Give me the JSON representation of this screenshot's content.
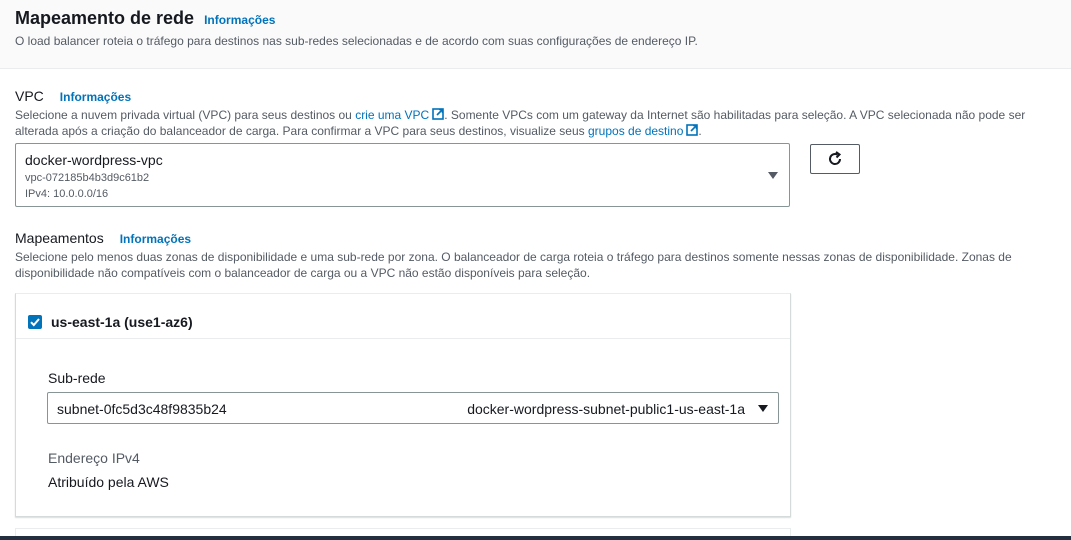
{
  "section": {
    "title": "Mapeamento de rede",
    "info_label": "Informações",
    "description": "O load balancer roteia o tráfego para destinos nas sub-redes selecionadas e de acordo com suas configurações de endereço IP."
  },
  "vpc": {
    "label": "VPC",
    "info_label": "Informações",
    "desc_part1": "Selecione a nuvem privada virtual (VPC) para seus destinos ou ",
    "create_vpc_link": "crie uma VPC",
    "desc_part2": ". Somente VPCs com um gateway da Internet são habilitadas para seleção. A VPC selecionada não pode ser alterada após a criação do balanceador de carga. Para confirmar a VPC para seus destinos, visualize seus ",
    "target_groups_link": "grupos de destino",
    "desc_part3": ".",
    "selected": {
      "name": "docker-wordpress-vpc",
      "id": "vpc-072185b4b3d9c61b2",
      "cidr": "IPv4: 10.0.0.0/16"
    },
    "refresh_icon": "refresh-icon"
  },
  "mappings": {
    "label": "Mapeamentos",
    "info_label": "Informações",
    "description": "Selecione pelo menos duas zonas de disponibilidade e uma sub-rede por zona. O balanceador de carga roteia o tráfego para destinos somente nessas zonas de disponibilidade. Zonas de disponibilidade não compatíveis com o balanceador de carga ou a VPC não estão disponíveis para seleção.",
    "zones": [
      {
        "name": "us-east-1a (use1-az6)",
        "checked": true,
        "subnet_label": "Sub-rede",
        "subnet_id": "subnet-0fc5d3c48f9835b24",
        "subnet_name": "docker-wordpress-subnet-public1-us-east-1a",
        "ipv4_label": "Endereço IPv4",
        "ipv4_value": "Atribuído pela AWS"
      }
    ]
  },
  "colors": {
    "link": "#0073bb",
    "text": "#16191f",
    "secondary_text": "#545b64",
    "border": "#879596"
  }
}
